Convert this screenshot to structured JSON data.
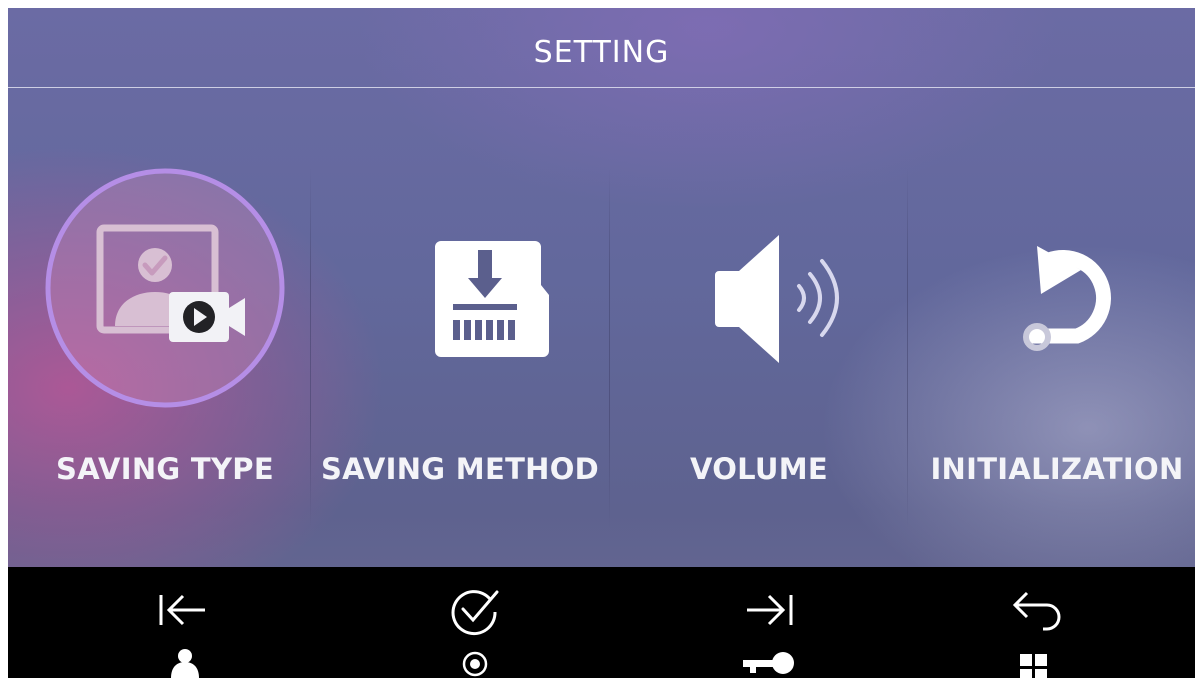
{
  "header": {
    "title": "SETTING"
  },
  "menu": {
    "items": [
      {
        "label": "SAVING TYPE",
        "icon": "saving-type-icon",
        "selected": true
      },
      {
        "label": "SAVING METHOD",
        "icon": "sd-card-download-icon",
        "selected": false
      },
      {
        "label": "VOLUME",
        "icon": "speaker-icon",
        "selected": false
      },
      {
        "label": "INITIALIZATION",
        "icon": "reset-icon",
        "selected": false
      }
    ],
    "selection_ring_color": "#b58ee6"
  },
  "navbar": {
    "buttons": [
      {
        "icon": "arrow-left-to-bar-icon",
        "sub_icon": "person-icon"
      },
      {
        "icon": "check-circle-icon",
        "sub_icon": "record-dot-icon"
      },
      {
        "icon": "arrow-right-to-bar-icon",
        "sub_icon": "key-icon"
      },
      {
        "icon": "back-arrow-icon",
        "sub_icon": "grid-icon"
      }
    ]
  }
}
